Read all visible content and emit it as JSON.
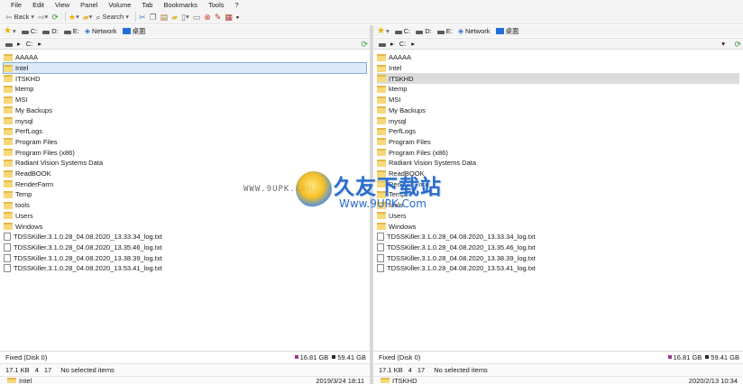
{
  "menu": [
    "File",
    "Edit",
    "View",
    "Panel",
    "Volume",
    "Tab",
    "Bookmarks",
    "Tools",
    "?"
  ],
  "toolbar": {
    "back_label": "Back",
    "search_label": "Search"
  },
  "drives": {
    "c": "C:",
    "d": "D:",
    "e": "E:",
    "network": "Network",
    "desktop": "桌面"
  },
  "path": {
    "drive_label": "C:"
  },
  "left_pane": {
    "items": [
      {
        "name": "AAAAA",
        "type": "folder"
      },
      {
        "name": "Intel",
        "type": "folder",
        "state": "selected"
      },
      {
        "name": "ITSKHD",
        "type": "folder"
      },
      {
        "name": "ktemp",
        "type": "folder"
      },
      {
        "name": "MSI",
        "type": "folder"
      },
      {
        "name": "My Backups",
        "type": "folder"
      },
      {
        "name": "mysql",
        "type": "folder"
      },
      {
        "name": "PerfLogs",
        "type": "folder"
      },
      {
        "name": "Program Files",
        "type": "folder"
      },
      {
        "name": "Program Files (x86)",
        "type": "folder"
      },
      {
        "name": "Radiant Vision Systems Data",
        "type": "folder"
      },
      {
        "name": "ReadBOOK",
        "type": "folder"
      },
      {
        "name": "RenderFarm",
        "type": "folder"
      },
      {
        "name": "Temp",
        "type": "folder"
      },
      {
        "name": "tools",
        "type": "folder"
      },
      {
        "name": "Users",
        "type": "folder"
      },
      {
        "name": "Windows",
        "type": "folder"
      },
      {
        "name": "TDSSKiller.3.1.0.28_04.08.2020_13.33.34_log.txt",
        "type": "file"
      },
      {
        "name": "TDSSKiller.3.1.0.28_04.08.2020_13.35.46_log.txt",
        "type": "file"
      },
      {
        "name": "TDSSKiller.3.1.0.28_04.08.2020_13.38.39_log.txt",
        "type": "file"
      },
      {
        "name": "TDSSKiller.3.1.0.28_04.08.2020_13.53.41_log.txt",
        "type": "file"
      }
    ],
    "status": {
      "disk": "Fixed (Disk 0)",
      "free": "16.81 GB",
      "total": "59.41 GB"
    },
    "info": {
      "size": "17.1 KB",
      "selected_count": "4",
      "item_count": "17",
      "selection_text": "No selected items"
    },
    "bottom": {
      "name": "Intel",
      "date": "2019/3/24 18:11"
    }
  },
  "right_pane": {
    "items": [
      {
        "name": "AAAAA",
        "type": "folder"
      },
      {
        "name": "Intel",
        "type": "folder"
      },
      {
        "name": "ITSKHD",
        "type": "folder",
        "state": "highlighted"
      },
      {
        "name": "ktemp",
        "type": "folder"
      },
      {
        "name": "MSI",
        "type": "folder"
      },
      {
        "name": "My Backups",
        "type": "folder"
      },
      {
        "name": "mysql",
        "type": "folder"
      },
      {
        "name": "PerfLogs",
        "type": "folder"
      },
      {
        "name": "Program Files",
        "type": "folder"
      },
      {
        "name": "Program Files (x86)",
        "type": "folder"
      },
      {
        "name": "Radiant Vision Systems Data",
        "type": "folder"
      },
      {
        "name": "ReadBOOK",
        "type": "folder"
      },
      {
        "name": "RenderFarm",
        "type": "folder"
      },
      {
        "name": "Temp",
        "type": "folder"
      },
      {
        "name": "tools",
        "type": "folder"
      },
      {
        "name": "Users",
        "type": "folder"
      },
      {
        "name": "Windows",
        "type": "folder"
      },
      {
        "name": "TDSSKiller.3.1.0.28_04.08.2020_13.33.34_log.txt",
        "type": "file"
      },
      {
        "name": "TDSSKiller.3.1.0.28_04.08.2020_13.35.46_log.txt",
        "type": "file"
      },
      {
        "name": "TDSSKiller.3.1.0.28_04.08.2020_13.38.39_log.txt",
        "type": "file"
      },
      {
        "name": "TDSSKiller.3.1.0.28_04.08.2020_13.53.41_log.txt",
        "type": "file"
      }
    ],
    "status": {
      "disk": "Fixed (Disk 0)",
      "free": "16.81 GB",
      "total": "59.41 GB"
    },
    "info": {
      "size": "17.1 KB",
      "selected_count": "4",
      "item_count": "17",
      "selection_text": "No selected items"
    },
    "bottom": {
      "name": "ITSKHD",
      "date": "2020/2/13 10:34"
    }
  },
  "colors": {
    "free_space": "#a0368f",
    "total_space": "#2a2a2a",
    "accent": "#2a6ccb"
  },
  "watermark": {
    "url_left": "WWW.9UPK.COM",
    "brand": "久友下载站",
    "url": "Www.9UPK.Com"
  }
}
